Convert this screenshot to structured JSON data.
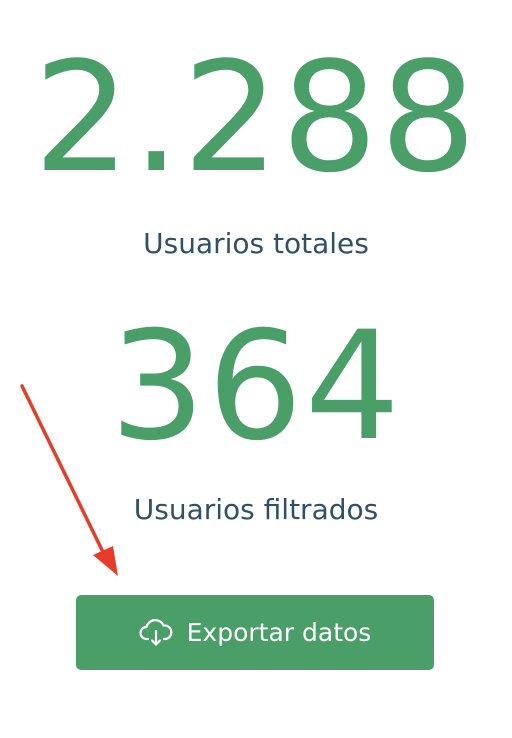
{
  "stats": {
    "total_value": "2.288",
    "total_label": "Usuarios totales",
    "filtered_value": "364",
    "filtered_label": "Usuarios filtrados"
  },
  "export": {
    "label": "Exportar datos",
    "icon": "cloud-download-icon"
  },
  "annotation": {
    "icon": "red-arrow-icon"
  },
  "colors": {
    "accent": "#4a9f68",
    "label_text": "#2f5066",
    "arrow": "#e53d2a",
    "background": "#ffffff"
  }
}
